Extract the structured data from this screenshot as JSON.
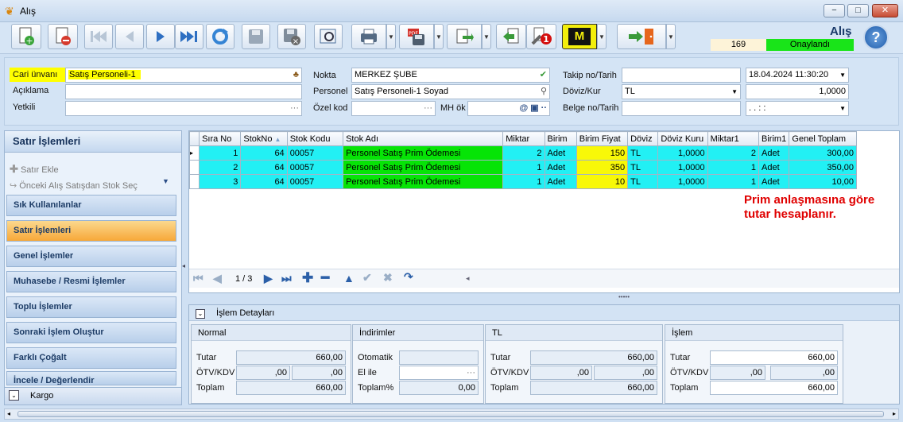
{
  "window": {
    "title": "Alış",
    "min": "−",
    "max": "□",
    "close": "✕"
  },
  "header": {
    "title": "Alış",
    "record_no": "169",
    "status": "Onaylandı",
    "help": "?"
  },
  "toolbar": {
    "m_label": "M",
    "badge": "1"
  },
  "form": {
    "cari_label": "Cari ünvanı",
    "cari_value": "Satış Personeli-1",
    "aciklama_label": "Açıklama",
    "aciklama_value": "",
    "yetkili_label": "Yetkili",
    "yetkili_value": "",
    "nokta_label": "Nokta",
    "nokta_value": "MERKEZ ŞUBE",
    "personel_label": "Personel",
    "personel_value": "Satış Personeli-1 Soyad",
    "ozelkod_label": "Özel kod",
    "ozelkod_value": "",
    "mhok_label": "MH ök",
    "mhok_value": "",
    "takip_label": "Takip no/Tarih",
    "takip_value": "",
    "takip_date": "18.04.2024 11:30:20",
    "doviz_label": "Döviz/Kur",
    "doviz_value": "TL",
    "kur_value": "1,0000",
    "belge_label": "Belge no/Tarih",
    "belge_value": "",
    "belge_date": ".  .      :  :"
  },
  "sidebar": {
    "title": "Satır İşlemleri",
    "actions": [
      "Satır Ekle",
      "Önceki Alış Satışdan Stok Seç"
    ],
    "items": [
      "Sık Kullanılanlar",
      "Satır İşlemleri",
      "Genel İşlemler",
      "Muhasebe / Resmi İşlemler",
      "Toplu İşlemler",
      "Sonraki İşlem Oluştur",
      "Farklı Çoğalt",
      "İncele / Değerlendir"
    ],
    "footer": "Kargo"
  },
  "grid": {
    "columns": [
      "Sıra No",
      "StokNo",
      "Stok Kodu",
      "Stok Adı",
      "Miktar",
      "Birim",
      "Birim Fiyat",
      "Döviz",
      "Döviz Kuru",
      "Miktar1",
      "Birim1",
      "Genel Toplam"
    ],
    "rows": [
      [
        "1",
        "64",
        "00057",
        "Personel Satış Prim Ödemesi",
        "2",
        "Adet",
        "150",
        "TL",
        "1,0000",
        "2",
        "Adet",
        "300,00"
      ],
      [
        "2",
        "64",
        "00057",
        "Personel Satış Prim Ödemesi",
        "1",
        "Adet",
        "350",
        "TL",
        "1,0000",
        "1",
        "Adet",
        "350,00"
      ],
      [
        "3",
        "64",
        "00057",
        "Personel Satış Prim Ödemesi",
        "1",
        "Adet",
        "10",
        "TL",
        "1,0000",
        "1",
        "Adet",
        "10,00"
      ]
    ],
    "pager": "1 / 3"
  },
  "note": {
    "line1": "Prim anlaşmasına göre",
    "line2": "tutar hesaplanır.",
    "color": "#e00000"
  },
  "details": {
    "title": "İşlem Detayları",
    "normal": {
      "title": "Normal",
      "tutar_label": "Tutar",
      "tutar": "660,00",
      "otv_label": "ÖTV/KDV",
      "otv": ",00",
      "kdv": ",00",
      "toplam_label": "Toplam",
      "toplam": "660,00"
    },
    "indirim": {
      "title": "İndirimler",
      "otomatik_label": "Otomatik",
      "otomatik": "",
      "elile_label": "El ile",
      "elile": "",
      "toplam_label": "Toplam%",
      "toplam": "0,00"
    },
    "tl": {
      "title": "TL",
      "tutar_label": "Tutar",
      "tutar": "660,00",
      "otv_label": "ÖTV/KDV",
      "otv": ",00",
      "kdv": ",00",
      "toplam_label": "Toplam",
      "toplam": "660,00"
    },
    "islem": {
      "title": "İşlem",
      "tutar_label": "Tutar",
      "tutar": "660,00",
      "otv_label": "ÖTV/KDV",
      "otv": ",00",
      "kdv": ",00",
      "toplam_label": "Toplam",
      "toplam": "660,00"
    }
  }
}
